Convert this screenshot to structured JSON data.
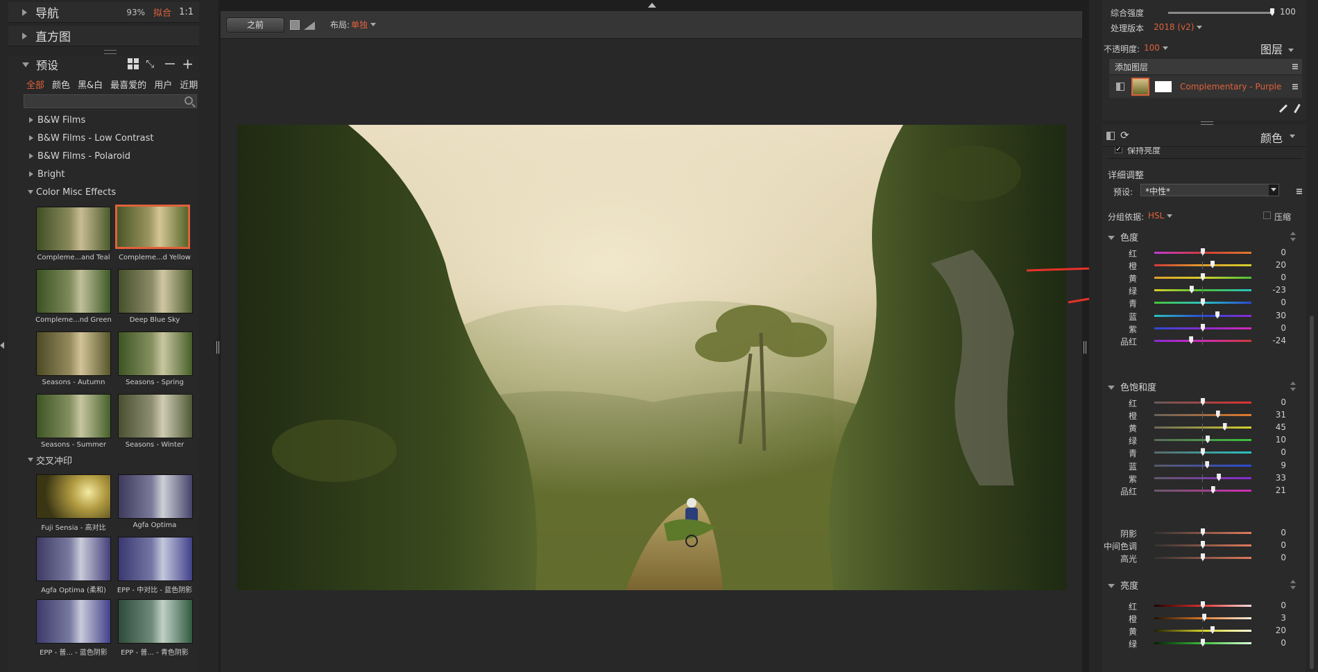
{
  "left_panel": {
    "navigator": {
      "title": "导航",
      "zoom": "93%",
      "fit": "拟合",
      "ratio": "1:1"
    },
    "histogram": {
      "title": "直方图"
    },
    "presets": {
      "title": "预设",
      "tabs": [
        "全部",
        "颜色",
        "黑&白",
        "最喜爱的",
        "用户",
        "近期"
      ],
      "active_tab": "全部",
      "search": {
        "value": "",
        "placeholder": ""
      },
      "folders": [
        {
          "label": "B&W Films",
          "expanded": false
        },
        {
          "label": "B&W Films - Low Contrast",
          "expanded": false
        },
        {
          "label": "B&W Films - Polaroid",
          "expanded": false
        },
        {
          "label": "Bright",
          "expanded": false
        },
        {
          "label": "Color Misc Effects",
          "expanded": true
        }
      ],
      "color_misc_thumbs": [
        "Compleme...and Teal",
        "Compleme...d Yellow",
        "Compleme...nd Green",
        "Deep Blue Sky",
        "Seasons - Autumn",
        "Seasons - Spring",
        "Seasons - Summer",
        "Seasons - Winter"
      ],
      "selected_thumb": "Compleme...d Yellow",
      "cross_folder": {
        "label": "交叉冲印",
        "expanded": true
      },
      "cross_thumbs": [
        "Fuji Sensia - 高对比",
        "Agfa Optima",
        "Agfa Optima (柔和)",
        "EPP - 中对比 - 蓝色阴影",
        "EPP - 普... - 蓝色阴影",
        "EPP - 普... - 青色阴影"
      ]
    }
  },
  "toolbar": {
    "before_label": "之前",
    "layout_label": "布局:",
    "layout_value": "单独"
  },
  "right_panel": {
    "overall": {
      "label": "综合强度",
      "value": "100",
      "level": 1.0
    },
    "process_version": {
      "label": "处理版本",
      "value": "2018 (v2)"
    },
    "opacity": {
      "label": "不透明度:",
      "value": "100"
    },
    "layers_title": "图层",
    "add_layer": "添加图层",
    "layer_name": "Complementary - Purple a...",
    "color_title": "颜色",
    "preserve_luminance": "保持亮度",
    "detail_title": "详细调整",
    "detail_preset_label": "预设:",
    "detail_preset_value": "*中性*",
    "group_by_label": "分组依据:",
    "group_by_value": "HSL",
    "compress_label": "压缩",
    "hue": {
      "title": "色度",
      "rows": [
        {
          "label": "红",
          "value": "0"
        },
        {
          "label": "橙",
          "value": "20"
        },
        {
          "label": "黄",
          "value": "0"
        },
        {
          "label": "绿",
          "value": "-23"
        },
        {
          "label": "青",
          "value": "0"
        },
        {
          "label": "蓝",
          "value": "30"
        },
        {
          "label": "紫",
          "value": "0"
        },
        {
          "label": "品红",
          "value": "-24"
        }
      ]
    },
    "saturation": {
      "title": "色饱和度",
      "rows": [
        {
          "label": "红",
          "value": "0"
        },
        {
          "label": "橙",
          "value": "31"
        },
        {
          "label": "黄",
          "value": "45"
        },
        {
          "label": "绿",
          "value": "10"
        },
        {
          "label": "青",
          "value": "0"
        },
        {
          "label": "蓝",
          "value": "9"
        },
        {
          "label": "紫",
          "value": "33"
        },
        {
          "label": "品红",
          "value": "21"
        }
      ],
      "tone_rows": [
        {
          "label": "阴影",
          "value": "0"
        },
        {
          "label": "中间色调",
          "value": "0"
        },
        {
          "label": "高光",
          "value": "0"
        }
      ]
    },
    "luminance": {
      "title": "亮度",
      "rows": [
        {
          "label": "红",
          "value": "0"
        },
        {
          "label": "橙",
          "value": "3"
        },
        {
          "label": "黄",
          "value": "20"
        },
        {
          "label": "绿",
          "value": "0"
        }
      ]
    }
  },
  "colors": {
    "accent": "#e0623c",
    "panel": "#2a2a2a"
  }
}
